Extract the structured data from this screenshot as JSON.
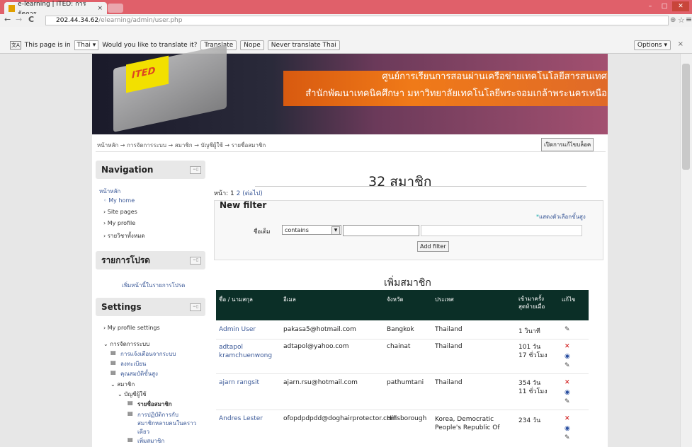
{
  "browser": {
    "tab_title": "e-learning | ITED: การจัดการ",
    "tab_close": "×",
    "url_host": "202.44.34.62",
    "url_path": "/elearning/admin/user.php",
    "back": "←",
    "forward": "→",
    "reload": "C",
    "translate": {
      "prefix": "This page is in",
      "language": "Thai ▾",
      "question": "Would you like to translate it?",
      "translate_btn": "Translate",
      "nope_btn": "Nope",
      "never_btn": "Never translate Thai",
      "options_btn": "Options ▾",
      "close": "×"
    }
  },
  "banner": {
    "line1": "ศูนย์การเรียนการสอนผ่านเครือข่ายเทคโนโลยีสารสนเทศ",
    "line2": "สำนักพัฒนาเทคนิคศึกษา มหาวิทยาลัยเทคโนโลยีพระจอมเกล้าพระนครเหนือ",
    "logo_text": "ITED"
  },
  "breadcrumb": "หน้าหลัก → การจัดการระบบ → สมาชิก → บัญชีผู้ใช้ → รายชื่อสมาชิก",
  "edit_block_btn": "เปิดการแก้ไขบล็อค",
  "navigation": {
    "title": "Navigation",
    "items": [
      "หน้าหลัก",
      "◦ My home",
      "› Site pages",
      "› My profile",
      "› รายวิชาทั้งหมด"
    ]
  },
  "favorites": {
    "title": "รายการโปรด",
    "add": "เพิ่มหน้านี้ในรายการโปรด"
  },
  "settings": {
    "title": "Settings",
    "items": [
      "› My profile settings",
      "⌄ การจัดการระบบ",
      "การแจ้งเตือนจากระบบ",
      "ลงทะเบียน",
      "คุณสมบัติขั้นสูง",
      "⌄ สมาชิก",
      "⌄ บัญชีผู้ใช้",
      "รายชื่อสมาชิก",
      "การปฏิบัติการกับ",
      "สมาชิกหลายคนในคราว",
      "เดียว",
      "เพิ่มสมาชิก"
    ]
  },
  "main": {
    "heading": "32 สมาชิก",
    "pager_label": "หน้า: 1",
    "pager_2": "2",
    "pager_next": "(ต่อไป)",
    "filter_title": "New filter",
    "advanced_star": "*",
    "advanced": "แสดงตัวเลือกขั้นสูง",
    "firstname_label": "ชื่อเต็ม",
    "operator": "contains",
    "add_filter": "Add filter",
    "add_member": "เพิ่มสมาชิก"
  },
  "table": {
    "headers": [
      "ชื่อ / นามสกุล",
      "อีเมล",
      "จังหวัด",
      "ประเทศ",
      "เข้ามาครั้งสุดท้ายเมื่อ",
      "แก้ไข"
    ],
    "rows": [
      {
        "name": "Admin User",
        "email": "pakasa5@hotmail.com",
        "city": "Bangkok",
        "country": "Thailand",
        "last": "1 วินาที"
      },
      {
        "name": "adtapol kramchuenwong",
        "email": "adtapol@yahoo.com",
        "city": "chainat",
        "country": "Thailand",
        "last": "101 วัน 17 ชั่วโมง"
      },
      {
        "name": "ajarn rangsit",
        "email": "ajarn.rsu@hotmail.com",
        "city": "pathumtani",
        "country": "Thailand",
        "last": "354 วัน 11 ชั่วโมง"
      },
      {
        "name": "Andres Lester",
        "email": "ofopdpdpdd@doghairprotector.com",
        "city": "Hillsborough",
        "country": "Korea, Democratic People's Republic Of",
        "last": "234 วัน"
      }
    ]
  },
  "colors": {
    "table_header": "#0b2f27",
    "link": "#3b5998",
    "chrome": "#e0606a"
  }
}
